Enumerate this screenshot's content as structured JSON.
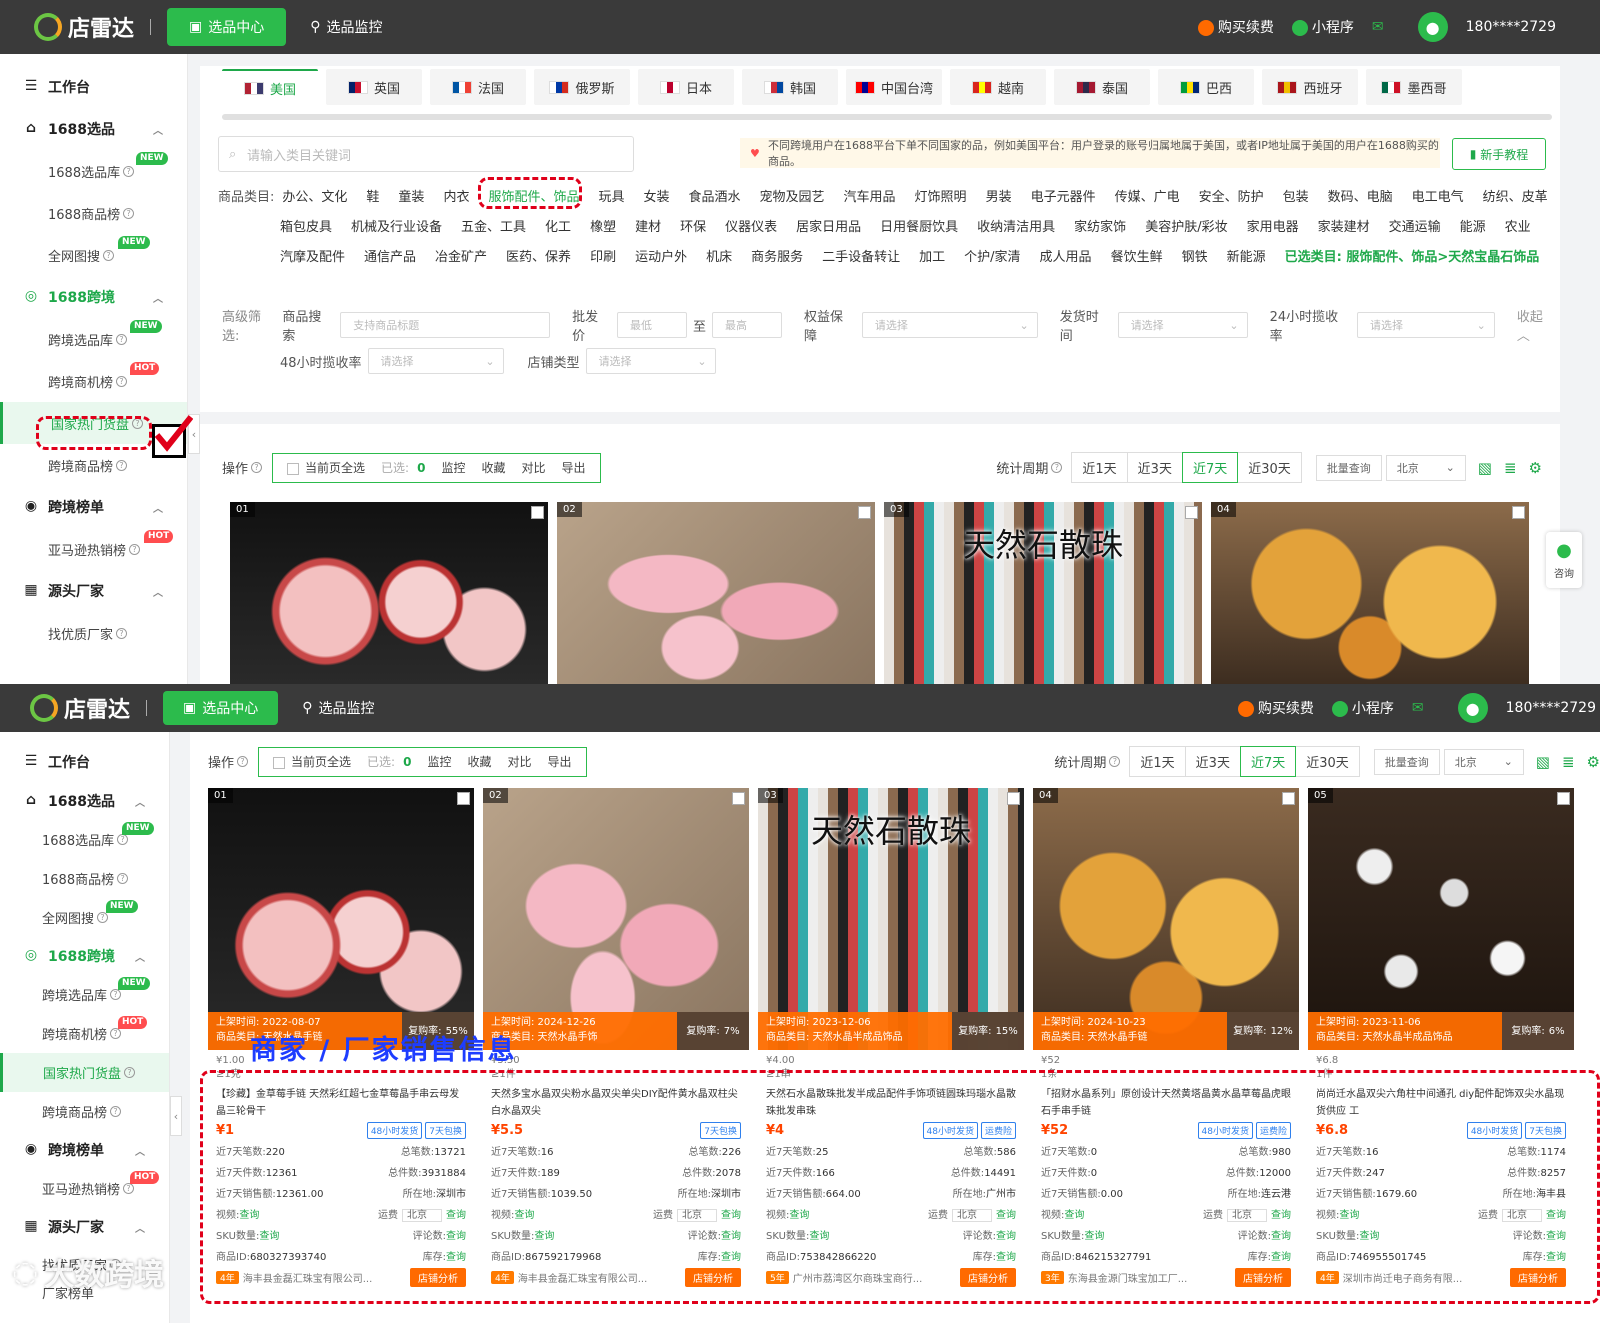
{
  "app": {
    "name": "店雷达"
  },
  "nav": {
    "center": "选品中心",
    "monitor": "选品监控",
    "buy": "购买续费",
    "mini": "小程序",
    "user": "180****2729"
  },
  "sidebar": {
    "workbench": "工作台",
    "g1688": "1688选品",
    "lib1688": "1688选品库",
    "rank1688": "1688商品榜",
    "imgsearch": "全网图搜",
    "gcross": "1688跨境",
    "crosslib": "跨境选品库",
    "crossbiz": "跨境商机榜",
    "hotgoods": "国家热门货盘",
    "crossrank": "跨境商品榜",
    "grank": "跨境榜单",
    "amazon": "亚马逊热销榜",
    "gfactory": "源头厂家",
    "findfactory": "找优质厂家",
    "factoryrank": "厂家榜单",
    "tag_new": "NEW",
    "tag_hot": "HOT"
  },
  "countries": [
    "美国",
    "英国",
    "法国",
    "俄罗斯",
    "日本",
    "韩国",
    "中国台湾",
    "越南",
    "泰国",
    "巴西",
    "西班牙",
    "墨西哥"
  ],
  "search": {
    "placeholder": "请输入类目关键词"
  },
  "notice": "不同跨境用户在1688平台下单不同国家的品，例如美国平台：用户登录的账号归属地属于美国，或者IP地址属于美国的用户在1688购买的商品。",
  "tutorial": "新手教程",
  "categories": {
    "label": "商品类目:",
    "row1": [
      "办公、文化",
      "鞋",
      "童装",
      "内衣",
      "服饰配件、饰品",
      "玩具",
      "女装",
      "食品酒水",
      "宠物及园艺",
      "汽车用品",
      "灯饰照明",
      "男装",
      "电子元器件",
      "传媒、广电",
      "安全、防护",
      "包装",
      "数码、电脑",
      "电工电气",
      "纺织、皮革"
    ],
    "row2": [
      "箱包皮具",
      "机械及行业设备",
      "五金、工具",
      "化工",
      "橡塑",
      "建材",
      "环保",
      "仪器仪表",
      "居家日用品",
      "日用餐厨饮具",
      "收纳清洁用具",
      "家纺家饰",
      "美容护肤/彩妆",
      "家用电器",
      "家装建材",
      "交通运输",
      "能源",
      "农业"
    ],
    "row3": [
      "汽摩及配件",
      "通信产品",
      "冶金矿产",
      "医药、保养",
      "印刷",
      "运动户外",
      "机床",
      "商务服务",
      "二手设备转让",
      "加工",
      "个护/家清",
      "成人用品",
      "餐饮生鲜",
      "钢铁",
      "新能源"
    ],
    "selected": "已选类目: 服饰配件、饰品>天然宝晶石饰品"
  },
  "filters": {
    "advanced": "高级筛选:",
    "search_label": "商品搜索",
    "search_ph": "支持商品标题",
    "price_label": "批发价",
    "min": "最低",
    "to": "至",
    "max": "最高",
    "rights": "权益保障",
    "select_ph": "请选择",
    "ship": "发货时间",
    "r24": "24小时揽收率",
    "collapse": "收起",
    "r48": "48小时揽收率",
    "shop": "店铺类型"
  },
  "ops": {
    "label": "操作",
    "all": "当前页全选",
    "selected": "已选:",
    "count": "0",
    "monitor": "监控",
    "fav": "收藏",
    "compare": "对比",
    "export": "导出",
    "period_label": "统计周期",
    "periods": [
      "近1天",
      "近3天",
      "近7天",
      "近30天"
    ],
    "batch": "批量查询",
    "region": "北京"
  },
  "consult": "咨询",
  "annotation": "商家 / 厂家销售信息",
  "watermark": "大数跨境",
  "products": [
    {
      "num": "01",
      "listed": "上架时间: 2022-08-07",
      "cat": "商品类目: 天然水晶手链",
      "rate": "55%",
      "lp": "¥1.00",
      "moq": "≥1克",
      "title": "【珍藏】金草莓手链 天然彩红超七金草莓晶手串云母发晶三轮骨干",
      "price": "¥1",
      "badges": [
        "48小时发货",
        "7天包换"
      ],
      "s7": "220",
      "total": "13721",
      "p7": "12361",
      "tp": "3931884",
      "amt": "12361.00",
      "loc": "深圳市",
      "sku": "SKU数量:",
      "id": "680327393740",
      "yrs": "4年",
      "shop": "海丰县金磊汇珠宝有限公司..."
    },
    {
      "num": "02",
      "listed": "上架时间: 2024-12-26",
      "cat": "商品类目: 天然水晶手饰",
      "rate": "7%",
      "lp": "¥5.50",
      "moq": "≥1件",
      "title": "天然多宝水晶双尖粉水晶双尖单尖DIY配件黄水晶双柱尖白水晶双尖",
      "price": "¥5.5",
      "badges": [
        "7天包换"
      ],
      "s7": "16",
      "total": "226",
      "p7": "189",
      "tp": "2078",
      "amt": "1039.50",
      "loc": "深圳市",
      "sku": "SKU数量:",
      "id": "867592179968",
      "yrs": "4年",
      "shop": "海丰县金磊汇珠宝有限公司..."
    },
    {
      "num": "03",
      "listed": "上架时间: 2023-12-06",
      "cat": "商品类目: 天然水晶半成品饰品",
      "rate": "15%",
      "lp": "¥4.00",
      "moq": "≥1串",
      "title": "天然石水晶散珠批发半成品配件手饰项链圆珠玛瑙水晶散珠批发串珠",
      "price": "¥4",
      "badges": [
        "48小时发货",
        "运费险"
      ],
      "s7": "25",
      "total": "586",
      "p7": "166",
      "tp": "14491",
      "amt": "664.00",
      "loc": "广州市",
      "sku": "SKU数量:",
      "id": "753842866220",
      "yrs": "5年",
      "shop": "广州市荔湾区尔商珠宝商行..."
    },
    {
      "num": "04",
      "listed": "上架时间: 2024-10-23",
      "cat": "商品类目: 天然水晶手链",
      "rate": "12%",
      "lp": "¥52",
      "moq": "1条",
      "title": "「招财水晶系列」原创设计天然黄塔晶黄水晶草莓晶虎眼石手串手链",
      "price": "¥52",
      "badges": [
        "48小时发货",
        "运费险"
      ],
      "s7": "0",
      "total": "980",
      "p7": "0",
      "tp": "12000",
      "amt": "0.00",
      "loc": "连云港",
      "sku": "SKU数量:",
      "id": "846215327791",
      "yrs": "3年",
      "shop": "东海县金源门珠宝加工厂..."
    },
    {
      "num": "05",
      "listed": "上架时间: 2023-11-06",
      "cat": "商品类目: 天然水晶半成品饰品",
      "rate": "6%",
      "lp": "¥6.8",
      "moq": "1件",
      "title": "尚尚迁水晶双尖六角柱中间通孔 diy配件配饰双尖水晶现货供应 工",
      "price": "¥6.8",
      "badges": [
        "48小时发货",
        "7天包换"
      ],
      "s7": "16",
      "total": "1174",
      "p7": "247",
      "tp": "8257",
      "amt": "1679.60",
      "loc": "海丰县",
      "sku": "SKU数量:",
      "id": "746955501745",
      "yrs": "4年",
      "shop": "深圳市尚迁电子商务有限..."
    }
  ],
  "stats_labels": {
    "s7": "近7天笔数:",
    "total": "总笔数:",
    "p7": "近7天件数:",
    "tp": "总件数:",
    "amt": "近7天销售额:",
    "loc": "所在地:",
    "video": "视频:",
    "query": "查询",
    "freight": "运费",
    "eval": "评论数:",
    "stock": "库存:",
    "pid": "商品ID:",
    "shopan": "店铺分析"
  },
  "top_images": [
    {
      "num": "01",
      "text": ""
    },
    {
      "num": "02",
      "text": ""
    },
    {
      "num": "03",
      "text": "天然石散珠"
    },
    {
      "num": "04",
      "text": ""
    }
  ]
}
